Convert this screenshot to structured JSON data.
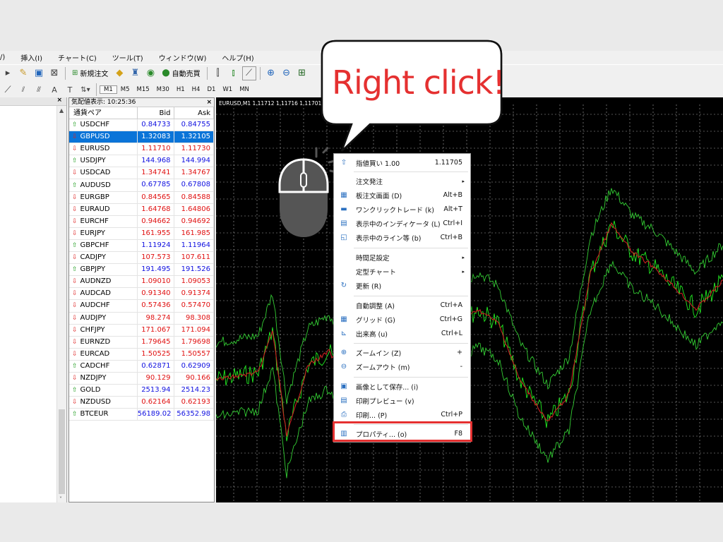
{
  "menu": [
    "/)",
    "挿入(I)",
    "チャート(C)",
    "ツール(T)",
    "ウィンドウ(W)",
    "ヘルプ(H)"
  ],
  "toolbar": {
    "new_order": "新規注文",
    "auto_trade": "自動売買",
    "periods": [
      "M1",
      "M5",
      "M15",
      "M30",
      "H1",
      "H4",
      "D1",
      "W1",
      "MN"
    ],
    "active_period": "M1"
  },
  "market_watch": {
    "title": "気配値表示: 10:25:36",
    "columns": [
      "通貨ペア",
      "Bid",
      "Ask"
    ],
    "rows": [
      {
        "symbol": "USDCHF",
        "bid": "0.84733",
        "ask": "0.84755",
        "dir": "up",
        "color": "blue"
      },
      {
        "symbol": "GBPUSD",
        "bid": "1.32083",
        "ask": "1.32105",
        "dir": "down",
        "color": "blue",
        "selected": true
      },
      {
        "symbol": "EURUSD",
        "bid": "1.11710",
        "ask": "1.11730",
        "dir": "down",
        "color": "red"
      },
      {
        "symbol": "USDJPY",
        "bid": "144.968",
        "ask": "144.994",
        "dir": "up",
        "color": "blue"
      },
      {
        "symbol": "USDCAD",
        "bid": "1.34741",
        "ask": "1.34767",
        "dir": "down",
        "color": "red"
      },
      {
        "symbol": "AUDUSD",
        "bid": "0.67785",
        "ask": "0.67808",
        "dir": "up",
        "color": "blue"
      },
      {
        "symbol": "EURGBP",
        "bid": "0.84565",
        "ask": "0.84588",
        "dir": "down",
        "color": "red"
      },
      {
        "symbol": "EURAUD",
        "bid": "1.64768",
        "ask": "1.64806",
        "dir": "down",
        "color": "red"
      },
      {
        "symbol": "EURCHF",
        "bid": "0.94662",
        "ask": "0.94692",
        "dir": "down",
        "color": "red"
      },
      {
        "symbol": "EURJPY",
        "bid": "161.955",
        "ask": "161.985",
        "dir": "down",
        "color": "red"
      },
      {
        "symbol": "GBPCHF",
        "bid": "1.11924",
        "ask": "1.11964",
        "dir": "up",
        "color": "blue"
      },
      {
        "symbol": "CADJPY",
        "bid": "107.573",
        "ask": "107.611",
        "dir": "down",
        "color": "red"
      },
      {
        "symbol": "GBPJPY",
        "bid": "191.495",
        "ask": "191.526",
        "dir": "up",
        "color": "blue"
      },
      {
        "symbol": "AUDNZD",
        "bid": "1.09010",
        "ask": "1.09053",
        "dir": "down",
        "color": "red"
      },
      {
        "symbol": "AUDCAD",
        "bid": "0.91340",
        "ask": "0.91374",
        "dir": "down",
        "color": "red"
      },
      {
        "symbol": "AUDCHF",
        "bid": "0.57436",
        "ask": "0.57470",
        "dir": "down",
        "color": "red"
      },
      {
        "symbol": "AUDJPY",
        "bid": "98.274",
        "ask": "98.308",
        "dir": "down",
        "color": "red"
      },
      {
        "symbol": "CHFJPY",
        "bid": "171.067",
        "ask": "171.094",
        "dir": "down",
        "color": "red"
      },
      {
        "symbol": "EURNZD",
        "bid": "1.79645",
        "ask": "1.79698",
        "dir": "down",
        "color": "red"
      },
      {
        "symbol": "EURCAD",
        "bid": "1.50525",
        "ask": "1.50557",
        "dir": "down",
        "color": "red"
      },
      {
        "symbol": "CADCHF",
        "bid": "0.62871",
        "ask": "0.62909",
        "dir": "up",
        "color": "blue"
      },
      {
        "symbol": "NZDJPY",
        "bid": "90.129",
        "ask": "90.166",
        "dir": "down",
        "color": "red"
      },
      {
        "symbol": "GOLD",
        "bid": "2513.94",
        "ask": "2514.23",
        "dir": "up",
        "color": "blue"
      },
      {
        "symbol": "NZDUSD",
        "bid": "0.62164",
        "ask": "0.62193",
        "dir": "down",
        "color": "red"
      },
      {
        "symbol": "BTCEUR",
        "bid": "56189.02",
        "ask": "56352.98",
        "dir": "up",
        "color": "blue"
      }
    ]
  },
  "chart": {
    "title": "EURUSD,M1  1.11712 1.11716 1.11701 1.11710"
  },
  "context_menu": {
    "items": [
      {
        "icon": "buy-limit-icon",
        "glyph": "⇧",
        "label": "指値買い 1.00",
        "shortcut": "1.11705"
      },
      {
        "label": "注文発注",
        "submenu": true
      },
      {
        "icon": "order-board-icon",
        "glyph": "▦",
        "label": "板注文画面 (D)",
        "shortcut": "Alt+B"
      },
      {
        "icon": "one-click-icon",
        "glyph": "▬",
        "label": "ワンクリックトレード (k)",
        "shortcut": "Alt+T"
      },
      {
        "icon": "indicator-icon",
        "glyph": "▤",
        "label": "表示中のインディケータ (L)",
        "shortcut": "Ctrl+I"
      },
      {
        "icon": "line-icon",
        "glyph": "◱",
        "label": "表示中のライン等 (b)",
        "shortcut": "Ctrl+B"
      },
      {
        "label": "時間足設定",
        "submenu": true
      },
      {
        "label": "定型チャート",
        "submenu": true
      },
      {
        "icon": "refresh-icon",
        "glyph": "↻",
        "label": "更新 (R)",
        "shortcut": ""
      },
      {
        "label": "自動調整 (A)",
        "shortcut": "Ctrl+A"
      },
      {
        "icon": "grid-icon",
        "glyph": "▦",
        "label": "グリッド (G)",
        "shortcut": "Ctrl+G"
      },
      {
        "icon": "volume-icon",
        "glyph": "⊾",
        "label": "出来高 (u)",
        "shortcut": "Ctrl+L"
      },
      {
        "icon": "zoom-in-icon",
        "glyph": "⊕",
        "label": "ズームイン (Z)",
        "shortcut": "+"
      },
      {
        "icon": "zoom-out-icon",
        "glyph": "⊖",
        "label": "ズームアウト (m)",
        "shortcut": "-"
      },
      {
        "icon": "save-image-icon",
        "glyph": "▣",
        "label": "画像として保存... (i)",
        "shortcut": ""
      },
      {
        "icon": "print-preview-icon",
        "glyph": "▤",
        "label": "印刷プレビュー (v)",
        "shortcut": ""
      },
      {
        "icon": "print-icon",
        "glyph": "⎙",
        "label": "印刷... (P)",
        "shortcut": "Ctrl+P"
      },
      {
        "icon": "properties-icon",
        "glyph": "▥",
        "label": "プロパティ... (o)",
        "shortcut": "F8"
      }
    ]
  },
  "callout": {
    "text": "Right click!"
  },
  "colors": {
    "accent_red": "#e53030",
    "selected_blue": "#0a74d8",
    "chart_bg": "#000000",
    "chart_green": "#22dd22",
    "chart_red": "#cc2222"
  }
}
